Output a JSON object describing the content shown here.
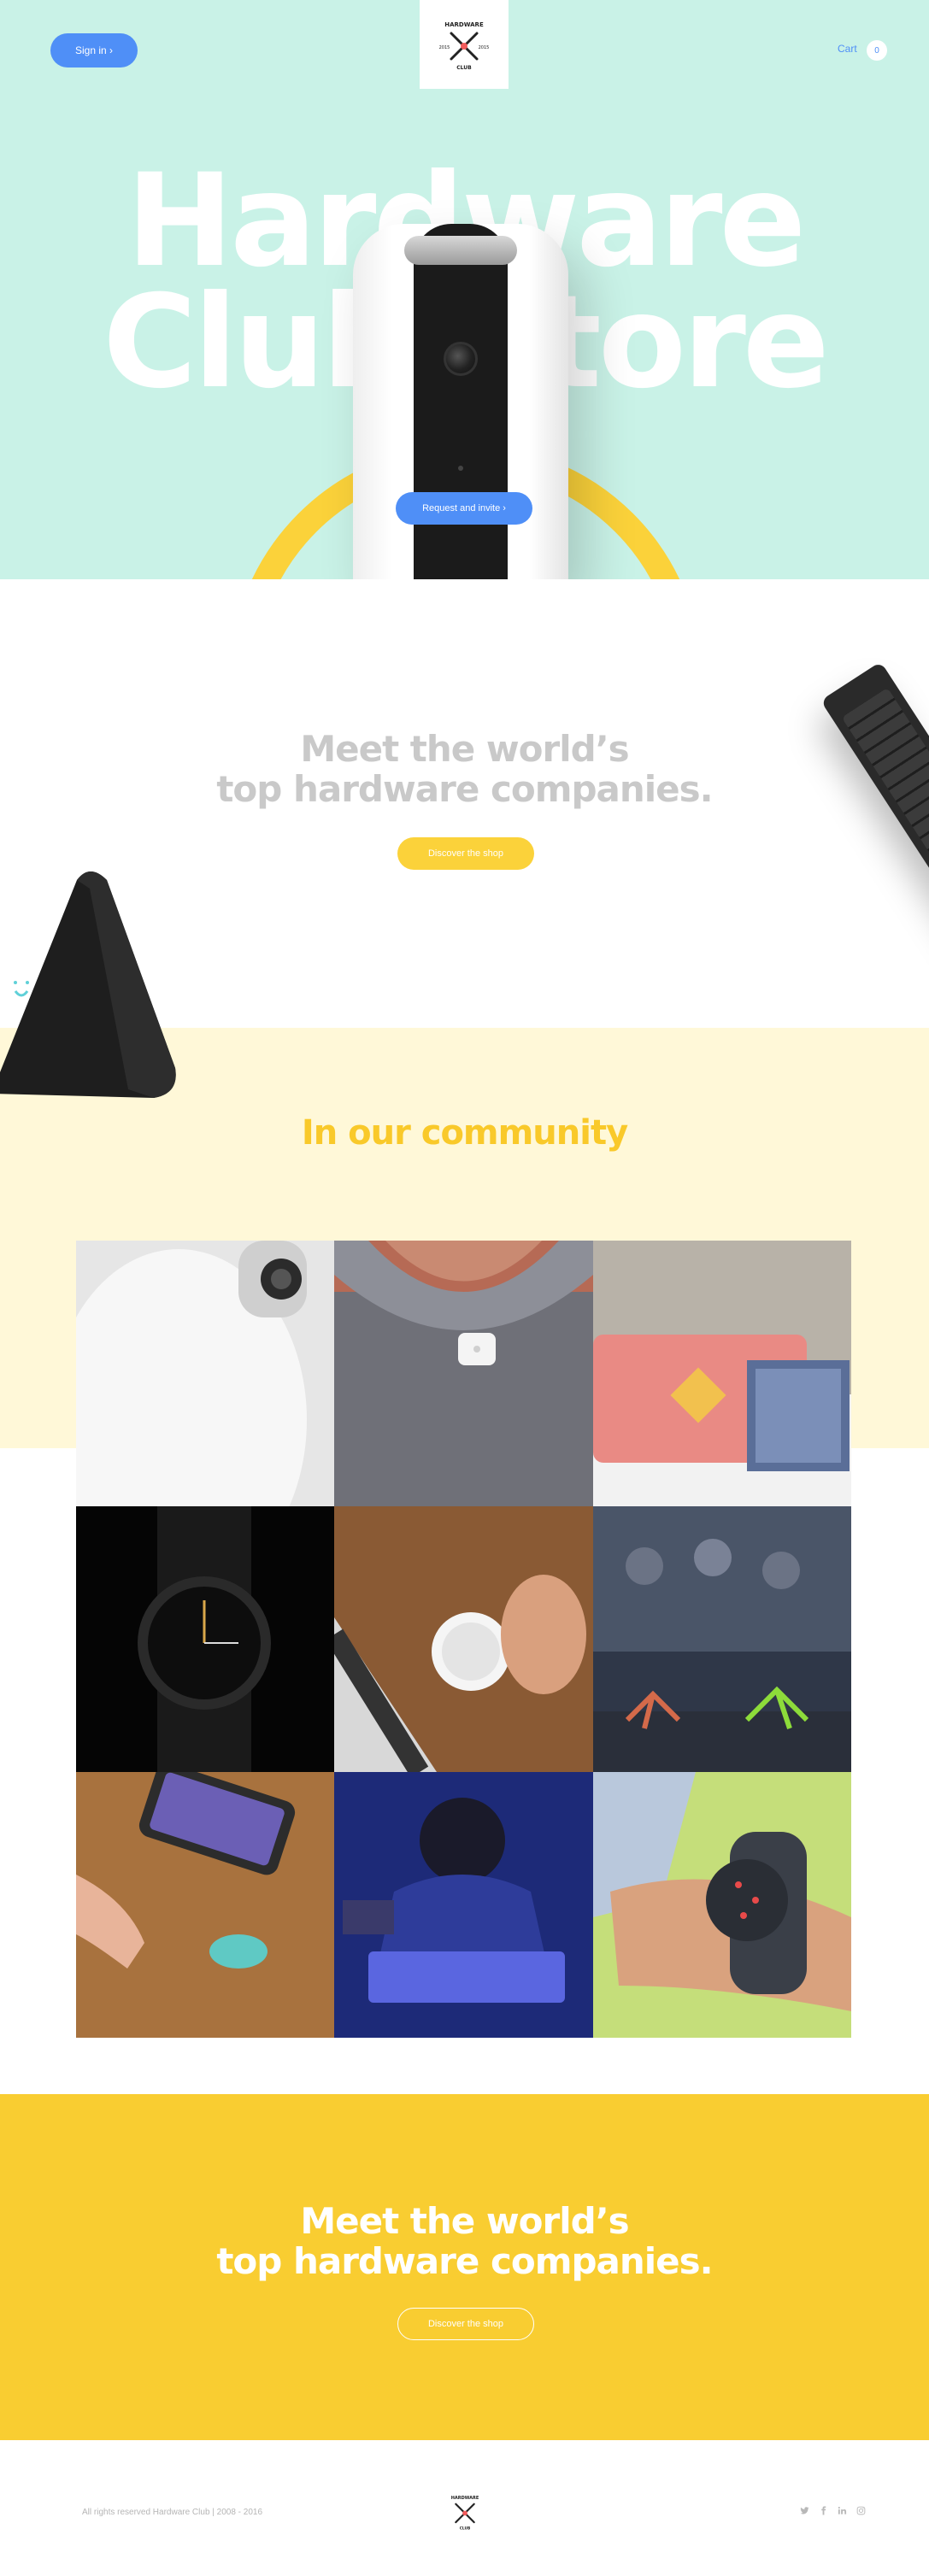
{
  "header": {
    "sign_in_label": "Sign in ›",
    "logo_text": "HARDWARE CLUB",
    "logo_year_left": "2015",
    "logo_year_right": "2015",
    "logo_sub": "CLUB",
    "cart_label": "Cart",
    "cart_count": "0"
  },
  "hero": {
    "title_line1": "Hardware",
    "title_line2": "Club Store",
    "request_button": "Request and invite ›"
  },
  "meet": {
    "title_line1": "Meet the world’s",
    "title_line2": "top hardware companies.",
    "discover_button": "Discover the shop"
  },
  "community": {
    "title": "In our community",
    "tiles": [
      {
        "name": "white-security-camera"
      },
      {
        "name": "wearable-clip-tracker"
      },
      {
        "name": "instant-photo-printer"
      },
      {
        "name": "smartwatch"
      },
      {
        "name": "smart-knob-controller"
      },
      {
        "name": "robot-spiders-crowd"
      },
      {
        "name": "smart-button-phone"
      },
      {
        "name": "music-keyboard-performer"
      },
      {
        "name": "fitness-tracker-watch"
      }
    ]
  },
  "cta": {
    "title_line1": "Meet the world’s",
    "title_line2": "top hardware companies.",
    "button": "Discover the shop"
  },
  "footer": {
    "copyright": "All rights reserved Hardware Club | 2008 - 2016",
    "socials": [
      "twitter-icon",
      "facebook-icon",
      "linkedin-icon",
      "instagram-icon"
    ]
  },
  "colors": {
    "hero_bg": "#c9f2e7",
    "accent_blue": "#4f8ff7",
    "accent_yellow": "#f9cd31",
    "community_bg": "#fff8d8"
  }
}
